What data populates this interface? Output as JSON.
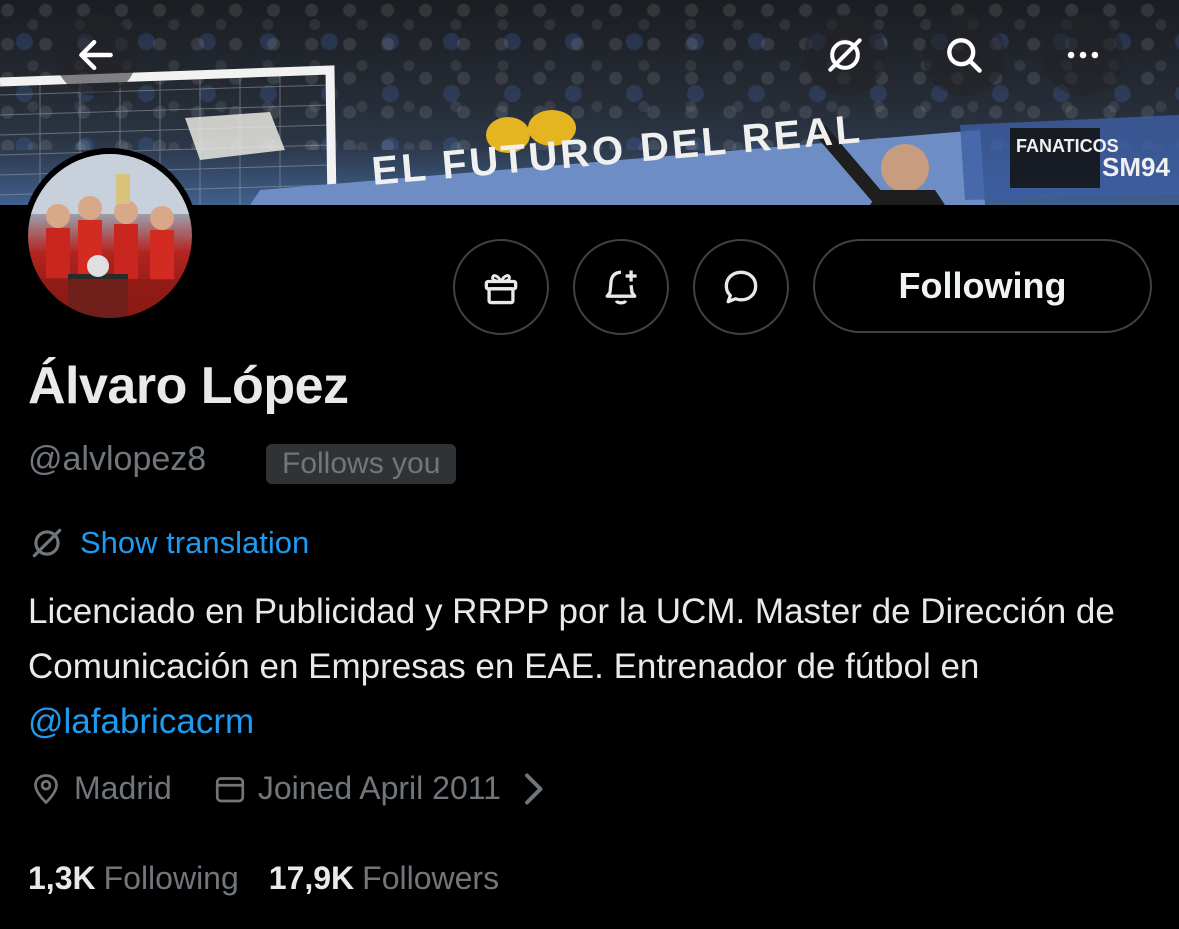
{
  "header": {
    "back_icon": "arrow-left-icon",
    "translate_icon": "translate-slash-icon",
    "search_icon": "search-icon",
    "more_icon": "more-dots-icon"
  },
  "banner": {
    "banner_text_left": "EL FUTURO DEL REAL",
    "banner_text_right": "SM94",
    "banner_text_sign": "FANATICOS"
  },
  "actions": {
    "gift_icon": "gift-icon",
    "notify_icon": "bell-plus-icon",
    "message_icon": "message-bubble-icon",
    "following_label": "Following"
  },
  "profile": {
    "name": "Álvaro López",
    "handle": "@alvlopez8",
    "follows_you": "Follows you",
    "show_translation": "Show translation",
    "bio_text": "Licenciado en Publicidad y RRPP por la UCM. Master de Dirección de Comunicación en Empresas en EAE. Entrenador de fútbol en ",
    "bio_mention": "@lafabricacrm",
    "location": "Madrid",
    "joined": "Joined April 2011",
    "following_count": "1,3K",
    "following_label": "Following",
    "followers_count": "17,9K",
    "followers_label": "Followers"
  },
  "colors": {
    "background": "#000000",
    "text_primary": "#e7e9ea",
    "text_secondary": "#71767b",
    "link": "#1d9bf0",
    "border": "#3f4145"
  }
}
